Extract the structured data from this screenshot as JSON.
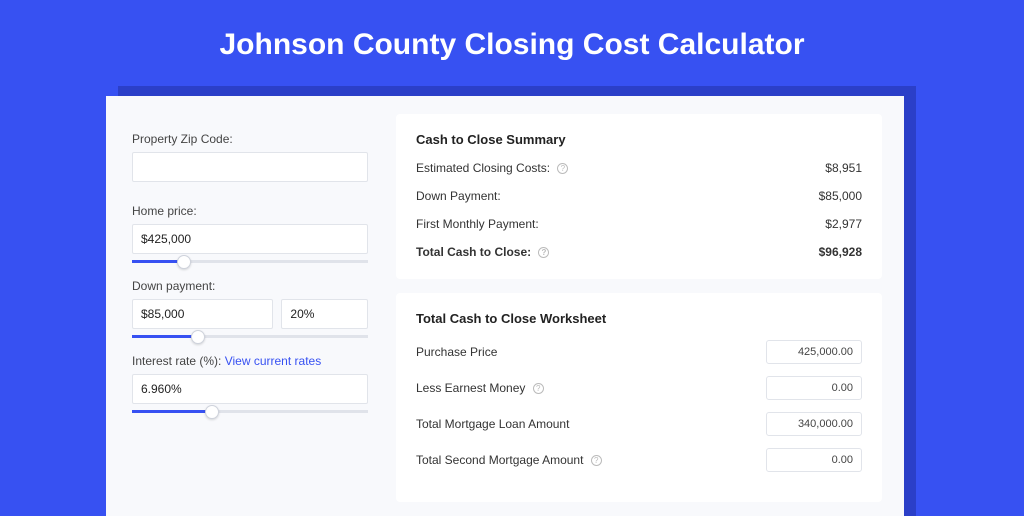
{
  "title": "Johnson County Closing Cost Calculator",
  "left": {
    "zip_label": "Property Zip Code:",
    "zip_value": "",
    "home_price_label": "Home price:",
    "home_price_value": "$425,000",
    "home_price_pct": 22,
    "down_payment_label": "Down payment:",
    "down_payment_value": "$85,000",
    "down_payment_pct_value": "20%",
    "down_payment_pct": 28,
    "interest_label": "Interest rate (%):",
    "interest_link": "View current rates",
    "interest_value": "6.960%",
    "interest_pct": 34
  },
  "summary": {
    "title": "Cash to Close Summary",
    "rows": [
      {
        "label": "Estimated Closing Costs:",
        "info": true,
        "value": "$8,951"
      },
      {
        "label": "Down Payment:",
        "info": false,
        "value": "$85,000"
      },
      {
        "label": "First Monthly Payment:",
        "info": false,
        "value": "$2,977"
      }
    ],
    "total_label": "Total Cash to Close:",
    "total_value": "$96,928"
  },
  "worksheet": {
    "title": "Total Cash to Close Worksheet",
    "rows": [
      {
        "label": "Purchase Price",
        "info": false,
        "value": "425,000.00"
      },
      {
        "label": "Less Earnest Money",
        "info": true,
        "value": "0.00"
      },
      {
        "label": "Total Mortgage Loan Amount",
        "info": false,
        "value": "340,000.00"
      },
      {
        "label": "Total Second Mortgage Amount",
        "info": true,
        "value": "0.00"
      }
    ]
  }
}
